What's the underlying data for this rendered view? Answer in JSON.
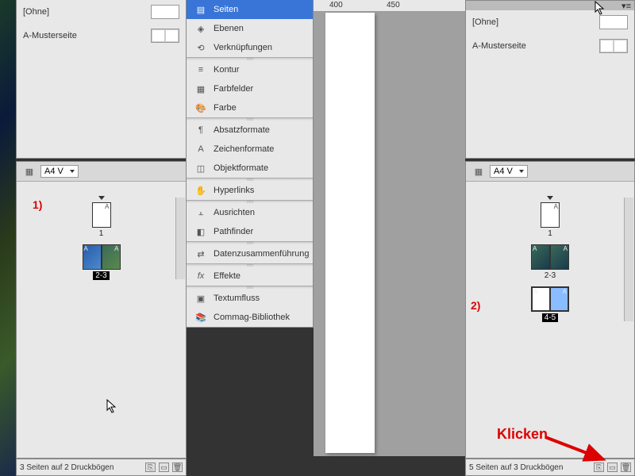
{
  "left": {
    "master_none": "[Ohne]",
    "master_a": "A-Musterseite",
    "size": "A4 V",
    "page1_label": "1",
    "spread_label": "2-3",
    "status": "3 Seiten auf 2 Druckbögen"
  },
  "right": {
    "master_none": "[Ohne]",
    "master_a": "A-Musterseite",
    "size": "A4 V",
    "page1_label": "1",
    "spread1_label": "2-3",
    "spread2_label": "4-5",
    "status": "5 Seiten auf 3 Druckbögen"
  },
  "ruler": {
    "t1": "400",
    "t2": "450"
  },
  "flyout": {
    "items": [
      {
        "label": "Seiten",
        "selected": true,
        "icon": "pages-icon"
      },
      {
        "label": "Ebenen",
        "selected": false,
        "icon": "layers-icon"
      },
      {
        "label": "Verknüpfungen",
        "selected": false,
        "icon": "links-icon"
      }
    ],
    "g2": [
      {
        "label": "Kontur",
        "icon": "stroke-icon"
      },
      {
        "label": "Farbfelder",
        "icon": "swatches-icon"
      },
      {
        "label": "Farbe",
        "icon": "color-icon"
      }
    ],
    "g3": [
      {
        "label": "Absatzformate",
        "icon": "paragraph-styles-icon"
      },
      {
        "label": "Zeichenformate",
        "icon": "character-styles-icon"
      },
      {
        "label": "Objektformate",
        "icon": "object-styles-icon"
      }
    ],
    "g4": [
      {
        "label": "Hyperlinks",
        "icon": "hyperlinks-icon"
      }
    ],
    "g5": [
      {
        "label": "Ausrichten",
        "icon": "align-icon"
      },
      {
        "label": "Pathfinder",
        "icon": "pathfinder-icon"
      }
    ],
    "g6": [
      {
        "label": "Datenzusammenführung",
        "icon": "data-merge-icon"
      }
    ],
    "g7": [
      {
        "label": "Effekte",
        "icon": "effects-icon"
      }
    ],
    "g8": [
      {
        "label": "Textumfluss",
        "icon": "text-wrap-icon"
      },
      {
        "label": "Commag-Bibliothek",
        "icon": "library-icon"
      }
    ]
  },
  "ann": {
    "one": "1)",
    "two": "2)",
    "klicken": "Klicken"
  },
  "colors": {
    "accent": "#d00000",
    "highlight": "#3875d7"
  }
}
